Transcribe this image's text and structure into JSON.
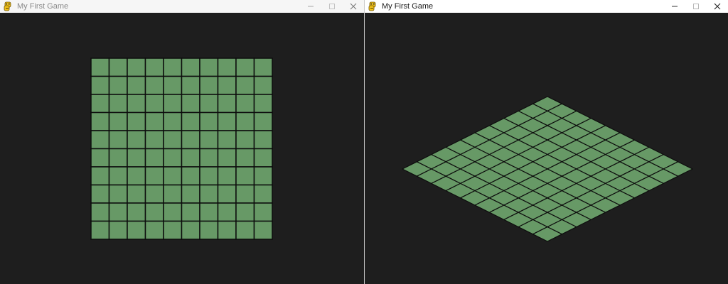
{
  "windows": [
    {
      "title": "My First Game",
      "focused": false,
      "view": "orthographic",
      "grid": {
        "rows": 10,
        "cols": 10
      }
    },
    {
      "title": "My First Game",
      "focused": true,
      "view": "isometric",
      "grid": {
        "rows": 10,
        "cols": 10
      }
    }
  ],
  "icons": {
    "app": "python-snake-icon",
    "minimize": "minimize-icon",
    "maximize": "maximize-icon",
    "close": "close-icon"
  },
  "colors": {
    "client_background": "#1e1e1e",
    "tile_fill": "#679966",
    "tile_outline": "#0d0d0d",
    "titlebar_inactive": "#f6f6f6",
    "titlebar_active": "#ffffff"
  }
}
